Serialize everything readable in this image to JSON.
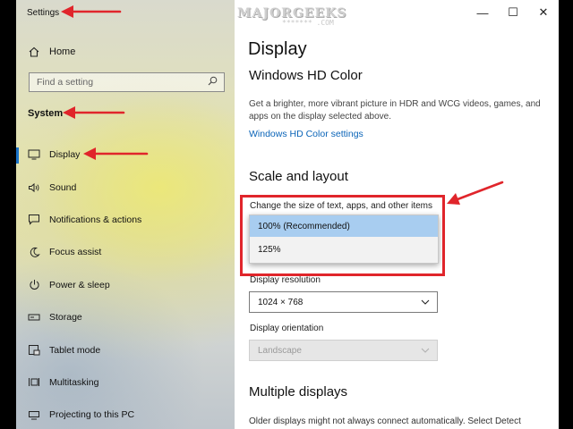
{
  "window": {
    "title": "Settings",
    "controls": {
      "minimize": "—",
      "maximize": "☐",
      "close": "✕"
    }
  },
  "watermark": {
    "text": "MAJORGEEKS",
    "sub": "******* .COM"
  },
  "sidebar": {
    "home_label": "Home",
    "search_placeholder": "Find a setting",
    "section_label": "System",
    "items": [
      {
        "label": "Display",
        "icon": "monitor-icon",
        "active": true
      },
      {
        "label": "Sound",
        "icon": "speaker-icon"
      },
      {
        "label": "Notifications & actions",
        "icon": "message-icon"
      },
      {
        "label": "Focus assist",
        "icon": "moon-icon"
      },
      {
        "label": "Power & sleep",
        "icon": "power-icon"
      },
      {
        "label": "Storage",
        "icon": "drive-icon"
      },
      {
        "label": "Tablet mode",
        "icon": "tablet-icon"
      },
      {
        "label": "Multitasking",
        "icon": "multitasking-icon"
      },
      {
        "label": "Projecting to this PC",
        "icon": "projector-icon"
      }
    ]
  },
  "main": {
    "page_title": "Display",
    "hd_color": {
      "heading": "Windows HD Color",
      "description": "Get a brighter, more vibrant picture in HDR and WCG videos, games, and apps on the display selected above.",
      "link": "Windows HD Color settings"
    },
    "scale_layout": {
      "heading": "Scale and layout",
      "scale_label": "Change the size of text, apps, and other items",
      "scale_options": [
        "100% (Recommended)",
        "125%"
      ],
      "scale_selected": "100% (Recommended)",
      "resolution_label": "Display resolution",
      "resolution_value": "1024 × 768",
      "orientation_label": "Display orientation",
      "orientation_value": "Landscape"
    },
    "multiple_displays": {
      "heading": "Multiple displays",
      "description": "Older displays might not always connect automatically. Select Detect"
    }
  },
  "colors": {
    "accent": "#1a73c9",
    "link": "#0a64b8",
    "annotation": "#e0252b",
    "selected_option": "#a8cdf0"
  }
}
